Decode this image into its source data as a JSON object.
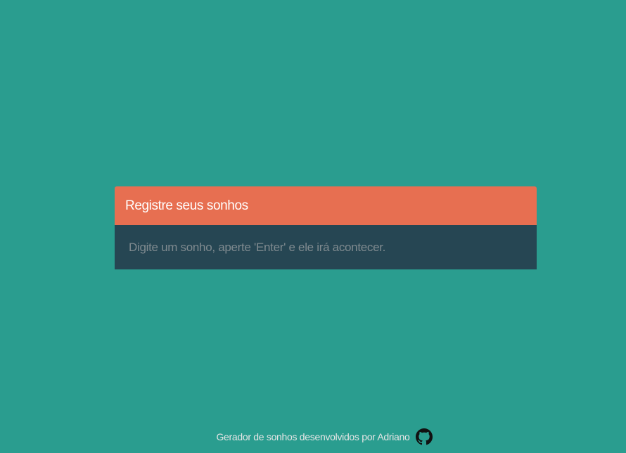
{
  "card": {
    "title": "Registre seus sonhos",
    "input_value": "",
    "input_placeholder": "Digite um sonho, aperte 'Enter' e ele irá acontecer."
  },
  "footer": {
    "text": "Gerador de sonhos desenvolvidos por Adriano",
    "icon": "github-icon"
  },
  "colors": {
    "background": "#2a9d8f",
    "header": "#e76f51",
    "input_background": "#264653",
    "title_text": "#ffffff",
    "footer_text": "#e6e6e6"
  }
}
